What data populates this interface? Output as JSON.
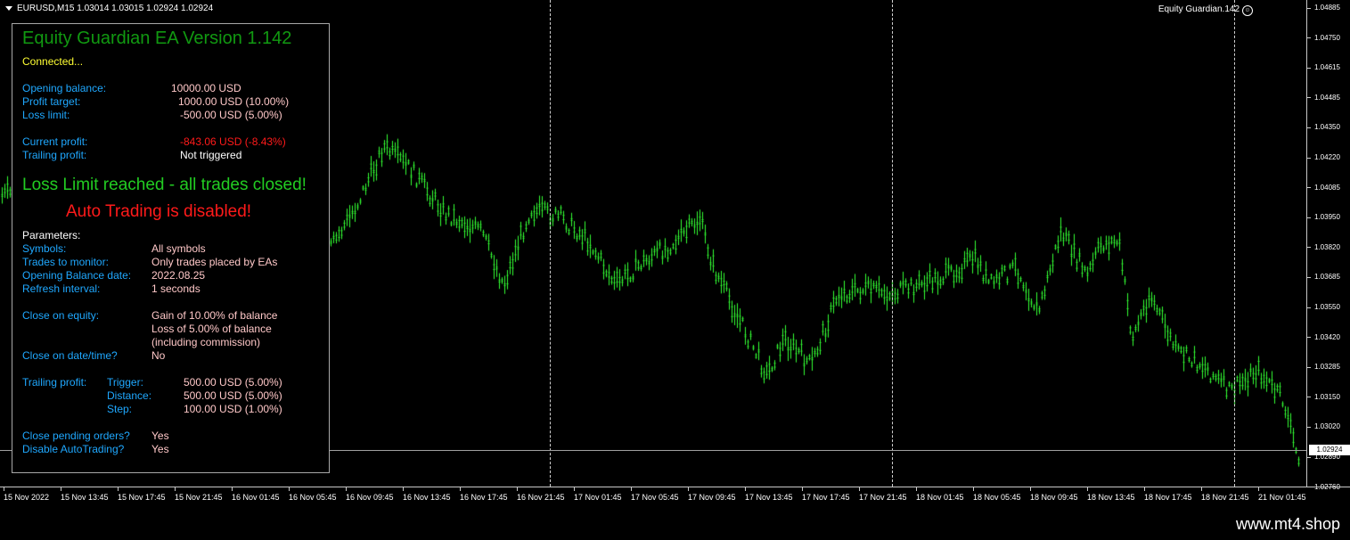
{
  "header": {
    "symbol_info": "EURUSD,M15  1.03014 1.03015 1.02924 1.02924",
    "ea_name": "Equity Guardian.142"
  },
  "colors": {
    "candles": "#33ff33",
    "background": "#000000",
    "label": "#1fa8ff",
    "value": "#ffc8c8",
    "title": "#119911",
    "status": "#ffff33",
    "alert_red": "#ff1a1a",
    "alert_green": "#22cc22"
  },
  "price_axis": [
    "1.04885",
    "1.04750",
    "1.04615",
    "1.04485",
    "1.04350",
    "1.04220",
    "1.04085",
    "1.03950",
    "1.03820",
    "1.03685",
    "1.03550",
    "1.03420",
    "1.03285",
    "1.03150",
    "1.03020",
    "1.02890",
    "1.02760"
  ],
  "current_price": "1.02924",
  "time_axis": [
    "15 Nov 2022",
    "15 Nov 13:45",
    "15 Nov 17:45",
    "15 Nov 21:45",
    "16 Nov 01:45",
    "16 Nov 05:45",
    "16 Nov 09:45",
    "16 Nov 13:45",
    "16 Nov 17:45",
    "16 Nov 21:45",
    "17 Nov 01:45",
    "17 Nov 05:45",
    "17 Nov 09:45",
    "17 Nov 13:45",
    "17 Nov 17:45",
    "17 Nov 21:45",
    "18 Nov 01:45",
    "18 Nov 05:45",
    "18 Nov 09:45",
    "18 Nov 13:45",
    "18 Nov 17:45",
    "18 Nov 21:45",
    "21 Nov 01:45"
  ],
  "panel": {
    "title": "Equity Guardian EA Version 1.142",
    "status": "Connected...",
    "opening_balance_label": "Opening balance:",
    "opening_balance_value": "10000.00 USD",
    "profit_target_label": "Profit target:",
    "profit_target_value": "1000.00 USD (10.00%)",
    "loss_limit_label": "Loss limit:",
    "loss_limit_value": "-500.00 USD (5.00%)",
    "current_profit_label": "Current profit:",
    "current_profit_value": "-843.06 USD (-8.43%)",
    "trailing_profit_label": "Trailing profit:",
    "trailing_profit_value": "Not triggered",
    "alert_loss": "Loss Limit reached - all trades closed!",
    "alert_autotrading": "Auto Trading is disabled!",
    "parameters_heading": "Parameters:",
    "symbols_label": "Symbols:",
    "symbols_value": "All symbols",
    "trades_label": "Trades to monitor:",
    "trades_value": "Only trades placed by EAs",
    "ob_date_label": "Opening Balance date:",
    "ob_date_value": "2022.08.25",
    "refresh_label": "Refresh interval:",
    "refresh_value": "1 seconds",
    "close_equity_label": "Close on equity:",
    "close_equity_line1": "Gain of 10.00% of balance",
    "close_equity_line2": "Loss of 5.00% of balance",
    "close_equity_line3": "(including commission)",
    "close_date_label": "Close on date/time?",
    "close_date_value": "No",
    "trailing_label": "Trailing profit:",
    "trigger_label": "Trigger:",
    "trigger_value": "500.00 USD (5.00%)",
    "distance_label": "Distance:",
    "distance_value": "500.00 USD (5.00%)",
    "step_label": "Step:",
    "step_value": "100.00 USD (1.00%)",
    "pending_label": "Close pending orders?",
    "pending_value": "Yes",
    "disable_label": "Disable AutoTrading?",
    "disable_value": "Yes"
  },
  "footer": {
    "url": "www.mt4.shop"
  }
}
